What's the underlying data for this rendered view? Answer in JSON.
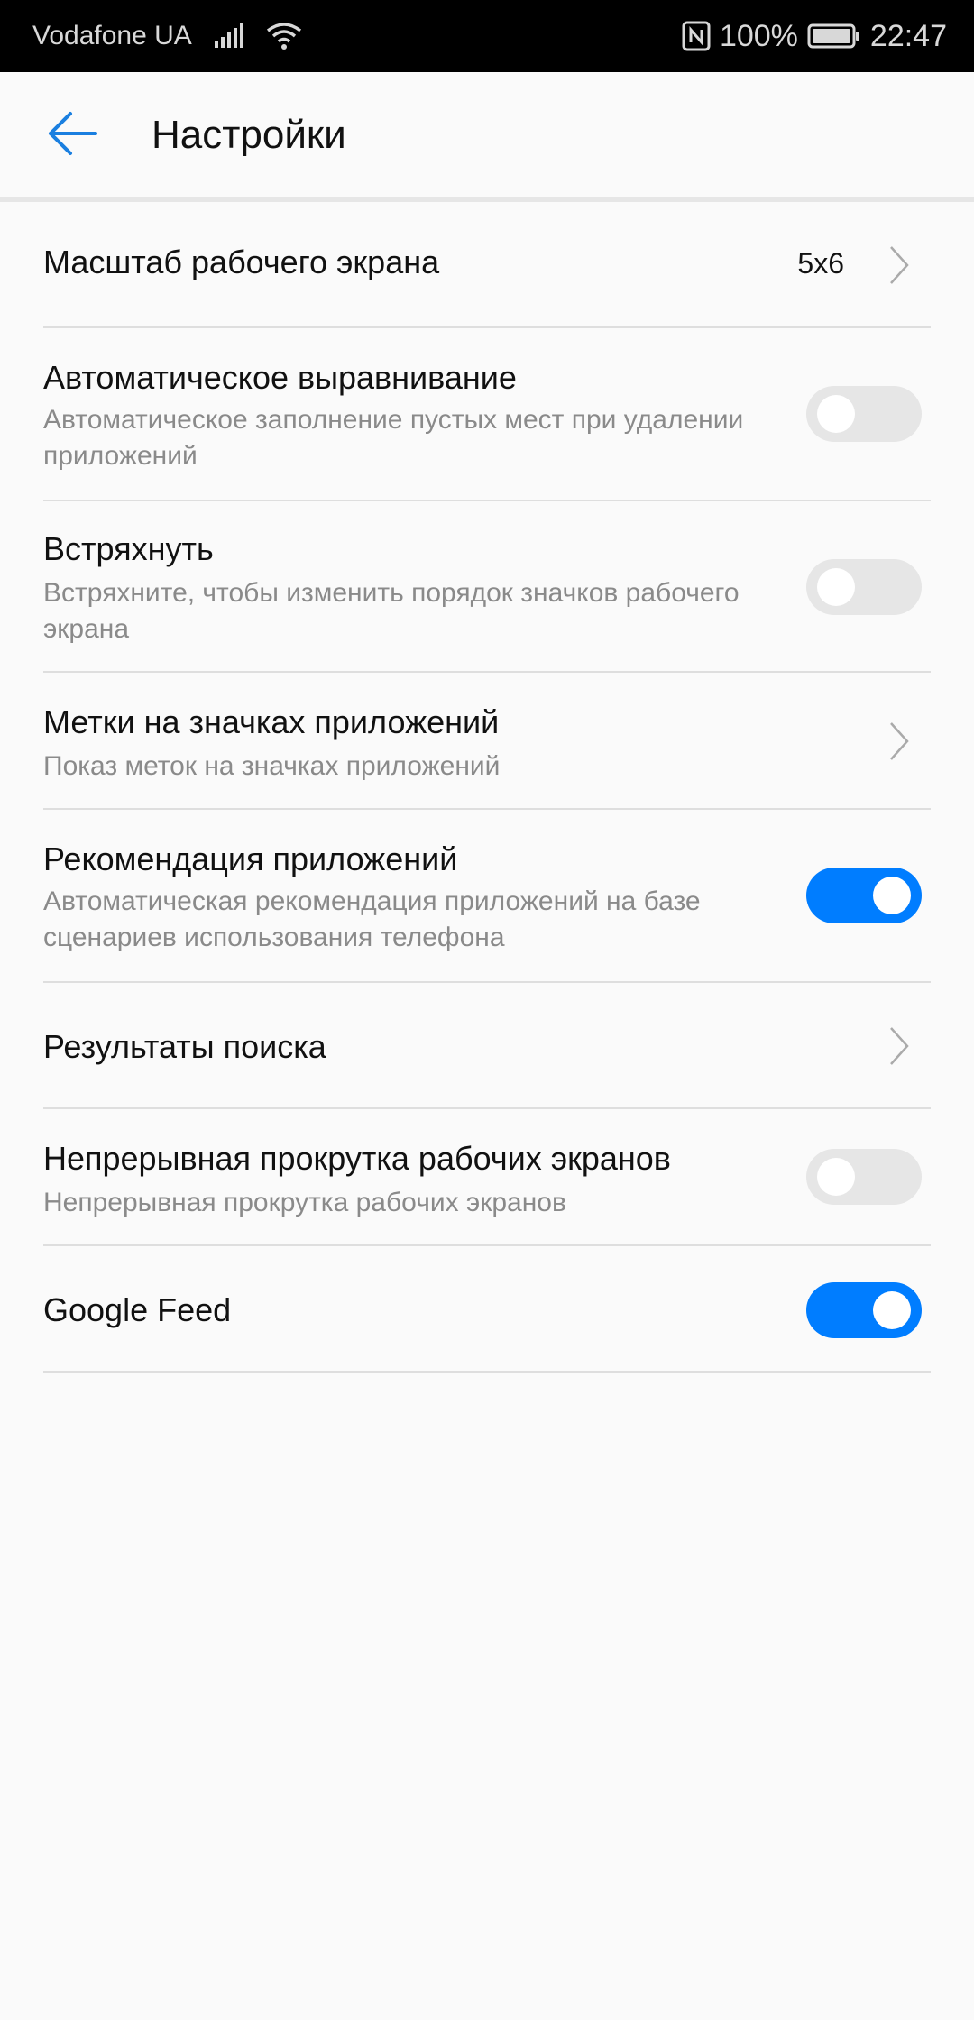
{
  "status_bar": {
    "carrier": "Vodafone UA",
    "battery": "100%",
    "time": "22:47",
    "icons": [
      "signal-icon",
      "wifi-icon",
      "nfc-icon",
      "battery-icon"
    ]
  },
  "app_bar": {
    "back_icon": "arrow-left-icon",
    "title": "Настройки"
  },
  "colors": {
    "accent": "#007dff",
    "toggle_off": "#e6e6e6"
  },
  "settings": [
    {
      "title": "Масштаб рабочего экрана",
      "value": "5x6",
      "control": "chevron"
    },
    {
      "title": "Автоматическое выравнивание",
      "subtitle": "Автоматическое заполнение пустых мест при удалении приложений",
      "control": "toggle",
      "on": false
    },
    {
      "title": "Встряхнуть",
      "subtitle": "Встряхните, чтобы изменить порядок значков рабочего экрана",
      "control": "toggle",
      "on": false
    },
    {
      "title": "Метки на значках приложений",
      "subtitle": "Показ меток на значках приложений",
      "control": "chevron"
    },
    {
      "title": "Рекомендация приложений",
      "subtitle": "Автоматическая рекомендация приложений на базе сценариев использования телефона",
      "control": "toggle",
      "on": true
    },
    {
      "title": "Результаты поиска",
      "control": "chevron"
    },
    {
      "title": "Непрерывная прокрутка рабочих экранов",
      "subtitle": "Непрерывная прокрутка рабочих экранов",
      "control": "toggle",
      "on": false
    },
    {
      "title": "Google Feed",
      "control": "toggle",
      "on": true
    }
  ]
}
